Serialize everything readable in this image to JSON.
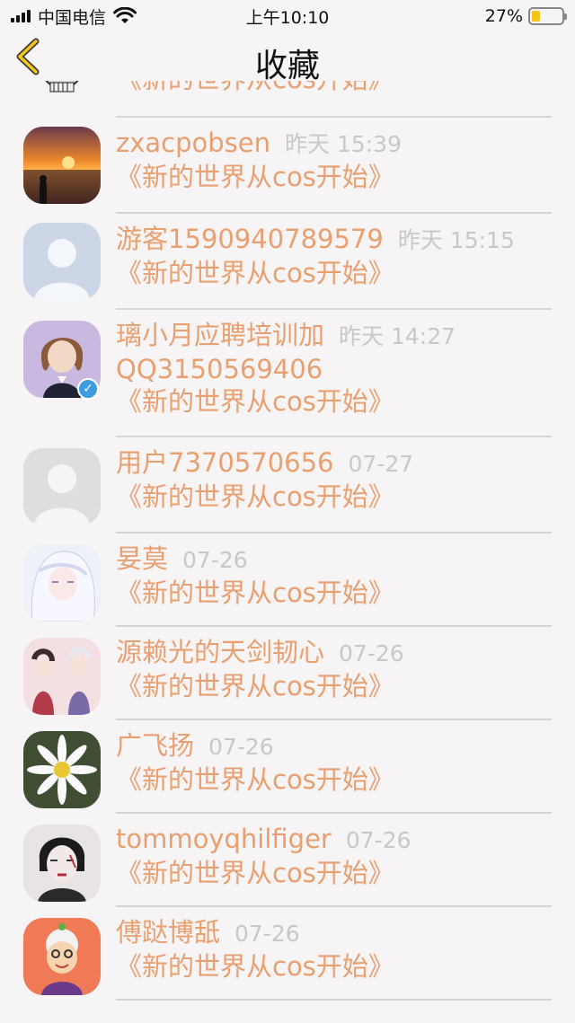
{
  "status": {
    "carrier": "中国电信",
    "time": "上午10:10",
    "battery_pct": "27%",
    "battery_level": 0.27
  },
  "nav": {
    "title": "收藏",
    "back_icon": "chevron-left-icon"
  },
  "items": [
    {
      "name": "",
      "time": "",
      "title": "《新的世界从cos开始》",
      "avatar": "skull"
    },
    {
      "name": "zxacpobsen",
      "time": "昨天 15:39",
      "title": "《新的世界从cos开始》",
      "avatar": "sunset"
    },
    {
      "name": "游客1590940789579",
      "time": "昨天 15:15",
      "title": "《新的世界从cos开始》",
      "avatar": "default-blue"
    },
    {
      "name": "璃小月应聘培训加",
      "name2": "QQ3150569406",
      "time": "昨天 14:27",
      "title": "《新的世界从cos开始》",
      "avatar": "anime-girl",
      "verified": true
    },
    {
      "name": "用户7370570656",
      "time": "07-27",
      "title": "《新的世界从cos开始》",
      "avatar": "default-gray"
    },
    {
      "name": "妟莫",
      "time": "07-26",
      "title": "《新的世界从cos开始》",
      "avatar": "white-hair"
    },
    {
      "name": "源赖光的天剑韧心",
      "time": "07-26",
      "title": "《新的世界从cos开始》",
      "avatar": "group-art"
    },
    {
      "name": "广飞扬",
      "time": "07-26",
      "title": "《新的世界从cos开始》",
      "avatar": "daisy"
    },
    {
      "name": "tommoyqhilfiger",
      "time": "07-26",
      "title": "《新的世界从cos开始》",
      "avatar": "painted-face"
    },
    {
      "name": "傅跶博舐",
      "time": "07-26",
      "title": "《新的世界从cos开始》",
      "avatar": "old-lady"
    }
  ],
  "colors": {
    "accent": "#e9a070",
    "time": "#c8c8c8",
    "background": "#f7f4f5",
    "divider": "#d8d4d5"
  }
}
